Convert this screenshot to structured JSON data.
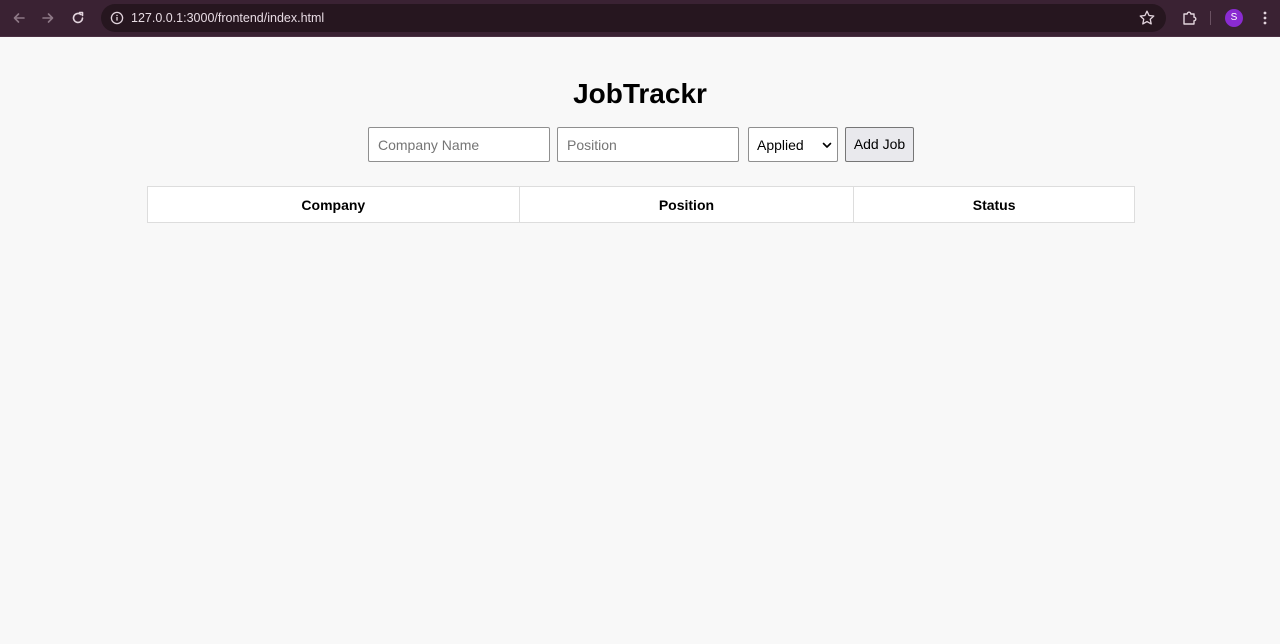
{
  "browser": {
    "url": "127.0.0.1:3000/frontend/index.html",
    "profile_initial": "S",
    "colors": {
      "toolbar_bg": "#3a2233",
      "omnibox_bg": "#26161f",
      "avatar": "#8a2bd1"
    },
    "icons": [
      "back-arrow-icon",
      "forward-arrow-icon",
      "reload-icon",
      "site-info-icon",
      "star-icon",
      "extensions-icon",
      "more-menu-icon"
    ]
  },
  "app": {
    "title": "JobTrackr",
    "form": {
      "company_placeholder": "Company Name",
      "company_value": "",
      "position_placeholder": "Position",
      "position_value": "",
      "status_selected": "Applied",
      "add_button_label": "Add Job"
    },
    "table": {
      "headers": [
        "Company",
        "Position",
        "Status"
      ],
      "rows": []
    }
  }
}
